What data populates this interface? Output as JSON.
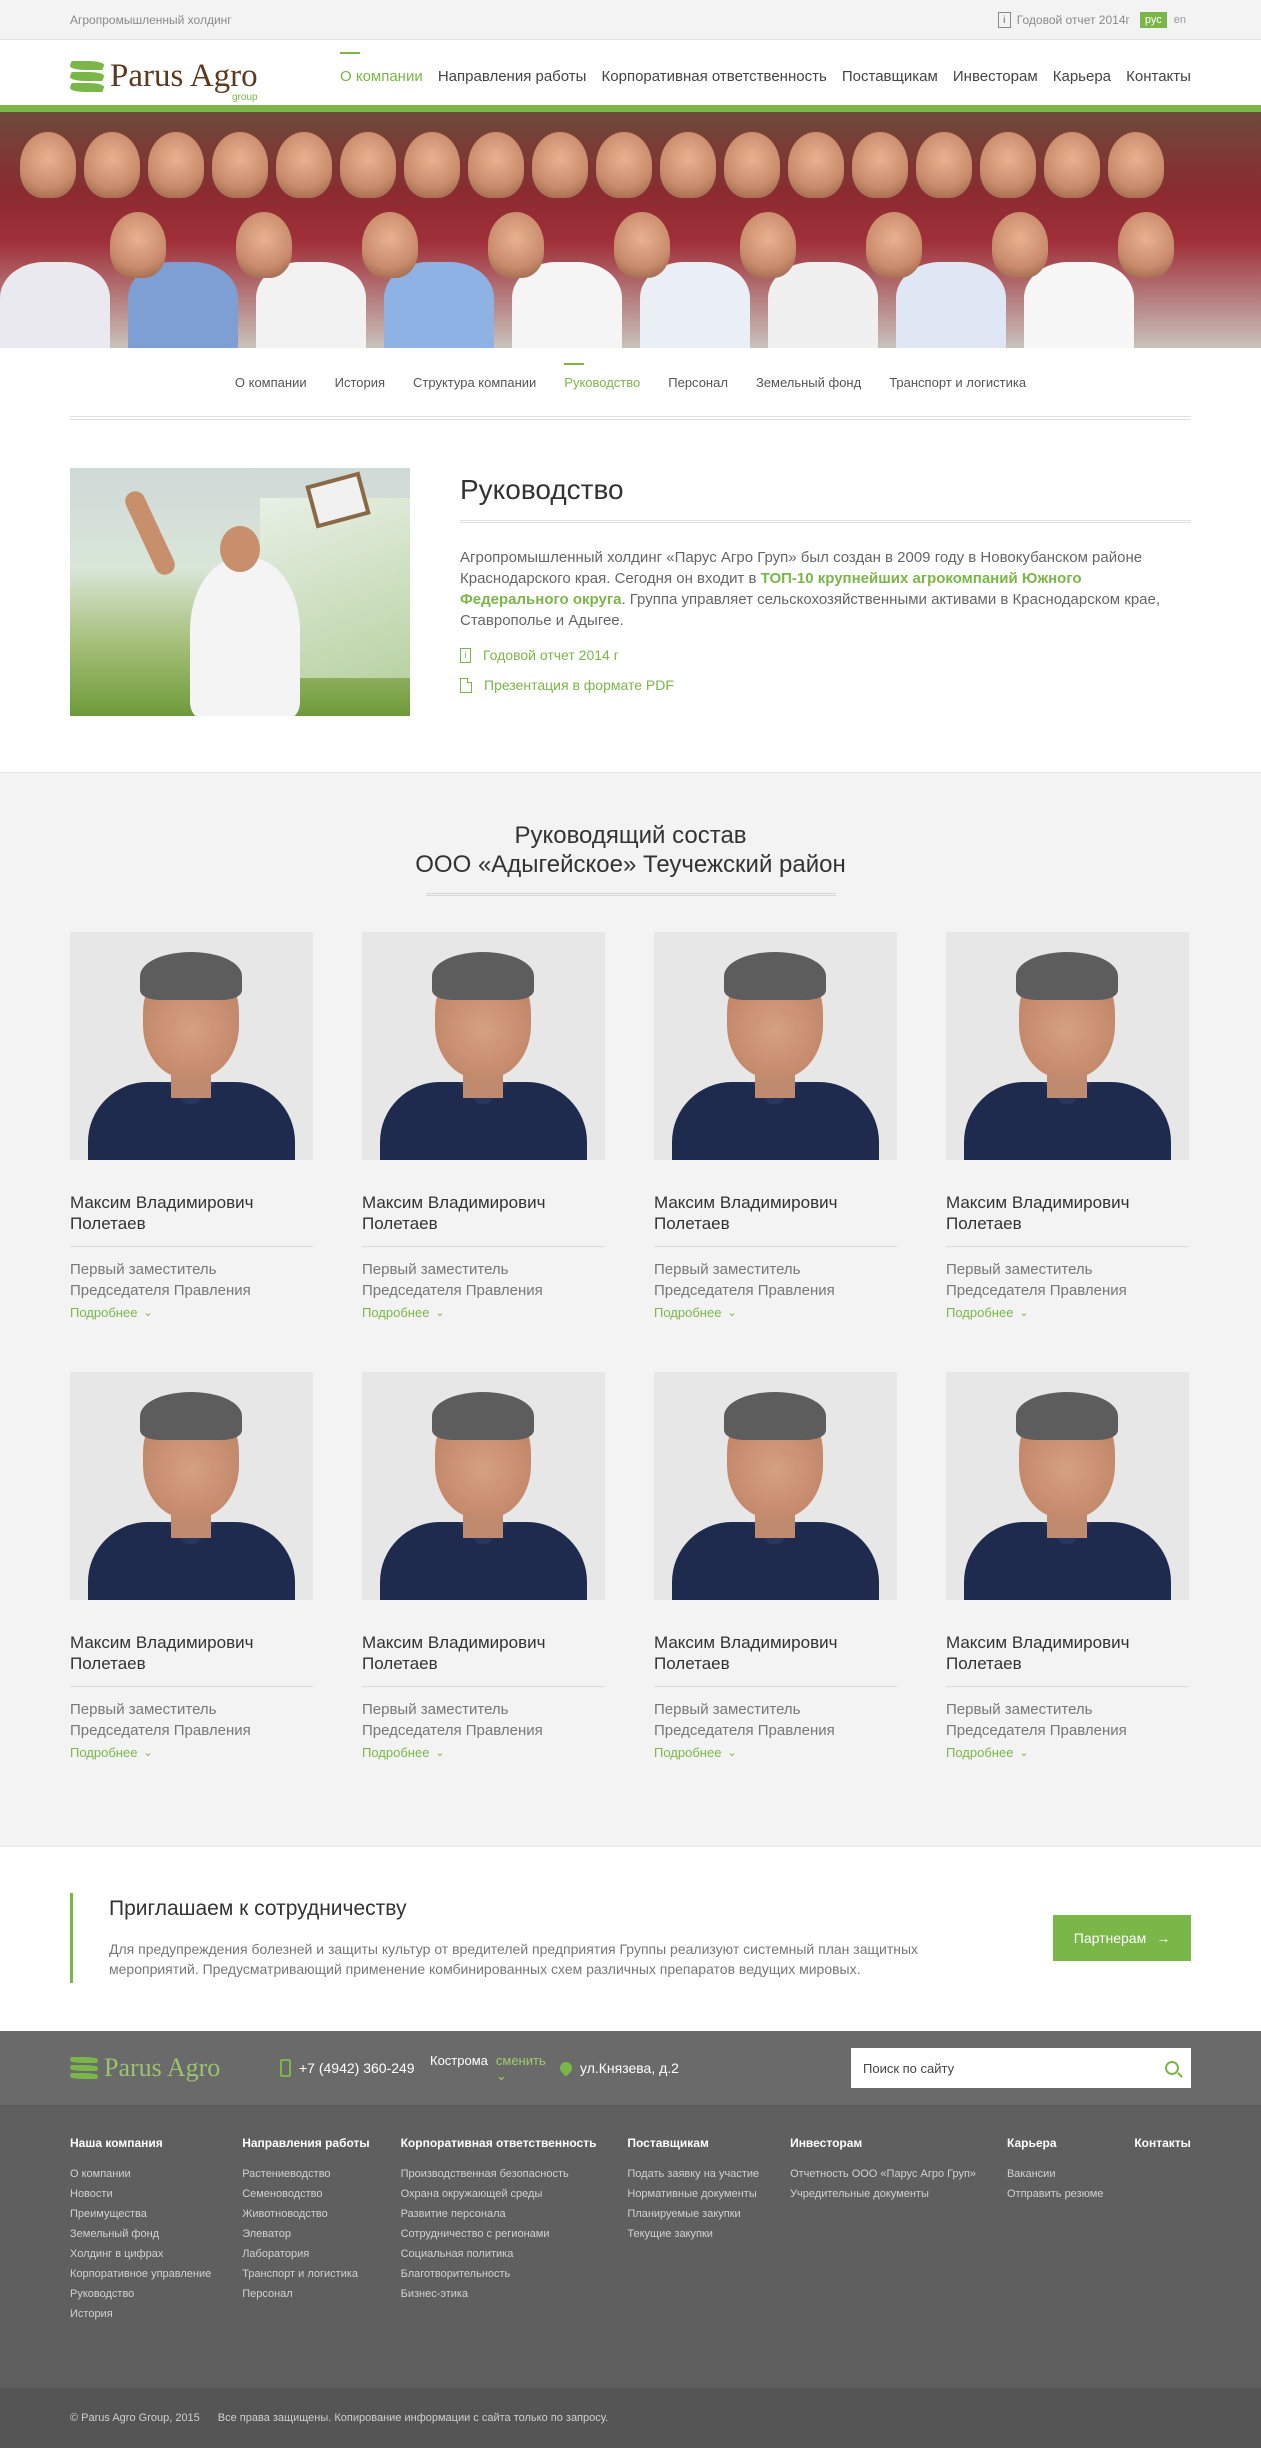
{
  "topbar": {
    "tagline": "Агропромышленный холдинг",
    "report": "Годовой отчет 2014г",
    "lang_ru": "рус",
    "lang_en": "en"
  },
  "logo": {
    "name": "Parus Agro",
    "sub": "group"
  },
  "mainnav": [
    "О компании",
    "Направления работы",
    "Корпоративная ответственность",
    "Поставщикам",
    "Инвесторам",
    "Карьера",
    "Контакты"
  ],
  "subnav": [
    "О компании",
    "История",
    "Структура компании",
    "Руководство",
    "Персонал",
    "Земельный фонд",
    "Транспорт и логистика"
  ],
  "intro": {
    "title": "Руководство",
    "text_a": "Агропромышленный холдинг «Парус Агро Груп» был создан в 2009 году в Новокубанском районе Краснодарского края. Сегодня он входит в ",
    "text_b": "ТОП-10 крупнейших агрокомпаний Южного Федерального округа",
    "text_c": ". Группа управляет сельскохозяйственными активами в Краснодарском крае, Ставрополье и Адыгее.",
    "link_report": "Годовой отчет 2014 г",
    "link_pdf": "Презентация в формате PDF"
  },
  "team": {
    "title1": "Руководящий состав",
    "title2": "ООО «Адыгейское» Теучежский район",
    "members": [
      {
        "name": "Максим Владимирович Полетаев",
        "role": "Первый заместитель Председателя Правления",
        "more": "Подробнее"
      },
      {
        "name": "Максим Владимирович Полетаев",
        "role": "Первый заместитель Председателя Правления",
        "more": "Подробнее"
      },
      {
        "name": "Максим Владимирович Полетаев",
        "role": "Первый заместитель Председателя Правления",
        "more": "Подробнее"
      },
      {
        "name": "Максим Владимирович Полетаев",
        "role": "Первый заместитель Председателя Правления",
        "more": "Подробнее"
      },
      {
        "name": "Максим Владимирович Полетаев",
        "role": "Первый заместитель Председателя Правления",
        "more": "Подробнее"
      },
      {
        "name": "Максим Владимирович Полетаев",
        "role": "Первый заместитель Председателя Правления",
        "more": "Подробнее"
      },
      {
        "name": "Максим Владимирович Полетаев",
        "role": "Первый заместитель Председателя Правления",
        "more": "Подробнее"
      },
      {
        "name": "Максим Владимирович Полетаев",
        "role": "Первый заместитель Председателя Правления",
        "more": "Подробнее"
      }
    ]
  },
  "cta": {
    "title": "Приглашаем к сотрудничеству",
    "text": "Для предупреждения болезней и защиты культур от вредителей предприятия Группы реализуют системный план защитных мероприятий. Предусматривающий применение комбинированных схем различных препаратов ведущих мировых.",
    "button": "Партнерам"
  },
  "footer": {
    "phone": "+7 (4942) 360-249",
    "city": "Кострома",
    "change": "сменить",
    "address": "ул.Князева, д.2",
    "search_placeholder": "Поиск по сайту",
    "columns": [
      {
        "title": "Наша компания",
        "items": [
          "О компании",
          "Новости",
          "Преимущества",
          "Земельный фонд",
          "Холдинг в цифрах",
          "Корпоративное управление",
          "Руководство",
          "История"
        ]
      },
      {
        "title": "Направления работы",
        "items": [
          "Растениеводство",
          "Семеноводство",
          "Животноводство",
          "Элеватор",
          "Лаборатория",
          "Транспорт и логистика",
          "Персонал"
        ]
      },
      {
        "title": "Корпоративная ответственность",
        "items": [
          "Производственная безопасность",
          "Охрана окружающей среды",
          "Развитие персонала",
          "Сотрудничество с регионами",
          "Социальная политика",
          "Благотворительность",
          "Бизнес-этика"
        ]
      },
      {
        "title": "Поставщикам",
        "items": [
          "Подать заявку на участие",
          "Нормативные документы",
          "Планируемые закупки",
          "Текущие закупки"
        ]
      },
      {
        "title": "Инвесторам",
        "items": [
          "Отчетность ООО «Парус Агро Груп»",
          "Учредительные документы"
        ]
      },
      {
        "title": "Карьера",
        "items": [
          "Вакансии",
          "Отправить резюме"
        ]
      },
      {
        "title": "Контакты",
        "items": []
      }
    ],
    "copyright": "© Parus Agro Group, 2015",
    "rights": "Все права защищены. Копирование информации с сайта  только по запросу."
  },
  "colors": {
    "accent": "#7ab648",
    "footer_bg": "#6a6a6a"
  }
}
